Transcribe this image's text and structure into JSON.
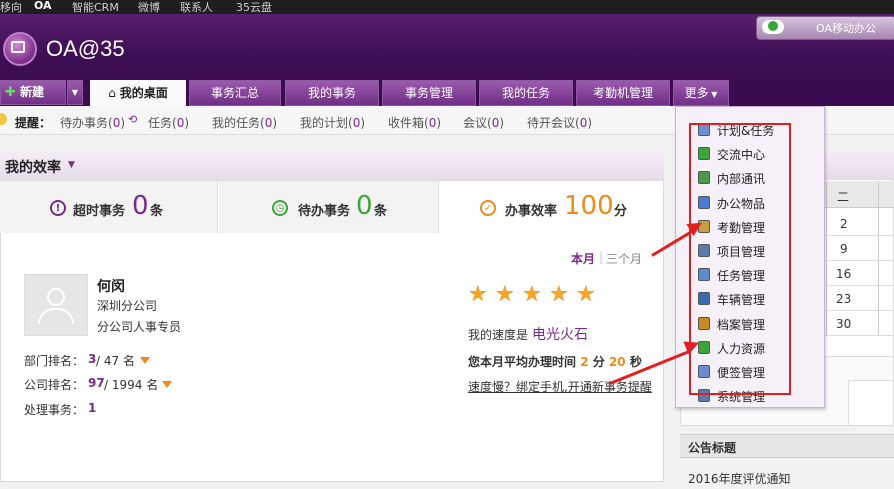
{
  "topnav": {
    "items": [
      "移向",
      "OA",
      "智能CRM",
      "微博",
      "联系人",
      "35云盘"
    ]
  },
  "header": {
    "app_name": "OA@35",
    "mobile_label": "OA移动办公"
  },
  "tabs": {
    "new_label": "新建",
    "items": [
      "我的桌面",
      "事务汇总",
      "我的事务",
      "事务管理",
      "我的任务",
      "考勤机管理",
      "更多"
    ],
    "active": "我的桌面"
  },
  "reminders": {
    "title": "提醒：",
    "items": [
      {
        "label": "待办事务",
        "count": "0"
      },
      {
        "label": "任务",
        "count": "0"
      },
      {
        "label": "我的任务",
        "count": "0"
      },
      {
        "label": "我的计划",
        "count": "0"
      },
      {
        "label": "收件箱",
        "count": "0"
      },
      {
        "label": "会议",
        "count": "0"
      },
      {
        "label": "待开会议",
        "count": "0"
      }
    ]
  },
  "efficiency": {
    "title": "我的效率",
    "stats": [
      {
        "label": "超时事务",
        "value": "0",
        "unit": "条",
        "color": "#7a2a8a"
      },
      {
        "label": "待办事务",
        "value": "0",
        "unit": "条",
        "color": "#3aa53a"
      },
      {
        "label": "办事效率",
        "value": "100",
        "unit": "分",
        "color": "#f08a1a"
      }
    ],
    "period_tabs": [
      "本月",
      "三个月"
    ],
    "period_sep": "|",
    "user": {
      "name": "何闵",
      "company": "深圳分公司",
      "role": "分公司人事专员"
    },
    "ranks": [
      {
        "label": "部门排名：",
        "value": "3",
        "total": " / 47 名"
      },
      {
        "label": "公司排名：",
        "value": "97",
        "total": " / 1994 名"
      },
      {
        "label": "处理事务：",
        "value": "1",
        "total": ""
      }
    ],
    "rating_stars": 5,
    "speed_label": "我的速度是",
    "speed_value": "电光火石",
    "avg_time_prefix": "您本月平均办理时间",
    "avg_time_min": "2",
    "avg_time_min_unit": "分",
    "avg_time_sec": "20",
    "avg_time_sec_unit": "秒",
    "slow_link": "速度慢？绑定手机,开通新事务提醒"
  },
  "calendar": {
    "header": "二",
    "dates": [
      "2",
      "9",
      "16",
      "23",
      "30"
    ]
  },
  "notice": {
    "title": "公告标题",
    "item": "2016年度评优通知"
  },
  "more_menu": {
    "items": [
      {
        "label": "计划&任务",
        "icon": "plan-icon",
        "color": "#6b8fd6"
      },
      {
        "label": "交流中心",
        "icon": "exchange-icon",
        "color": "#3aa53a"
      },
      {
        "label": "内部通讯",
        "icon": "phone-book-icon",
        "color": "#4a9a4a"
      },
      {
        "label": "办公物品",
        "icon": "office-supplies-icon",
        "color": "#4a7ad6"
      },
      {
        "label": "考勤管理",
        "icon": "attendance-icon",
        "color": "#c8a040"
      },
      {
        "label": "项目管理",
        "icon": "project-icon",
        "color": "#5a7ab0"
      },
      {
        "label": "任务管理",
        "icon": "task-icon",
        "color": "#5a8ad0"
      },
      {
        "label": "车辆管理",
        "icon": "car-icon",
        "color": "#3a6ab0"
      },
      {
        "label": "档案管理",
        "icon": "archive-icon",
        "color": "#c88a20"
      },
      {
        "label": "人力资源",
        "icon": "hr-icon",
        "color": "#3aa53a"
      },
      {
        "label": "便签管理",
        "icon": "note-icon",
        "color": "#6a8ad6"
      },
      {
        "label": "系统管理",
        "icon": "system-icon",
        "color": "#5a7ab0"
      }
    ]
  },
  "colors": {
    "brand": "#3f0f55",
    "accent": "#7a2a8a",
    "annotation": "#e02020"
  }
}
